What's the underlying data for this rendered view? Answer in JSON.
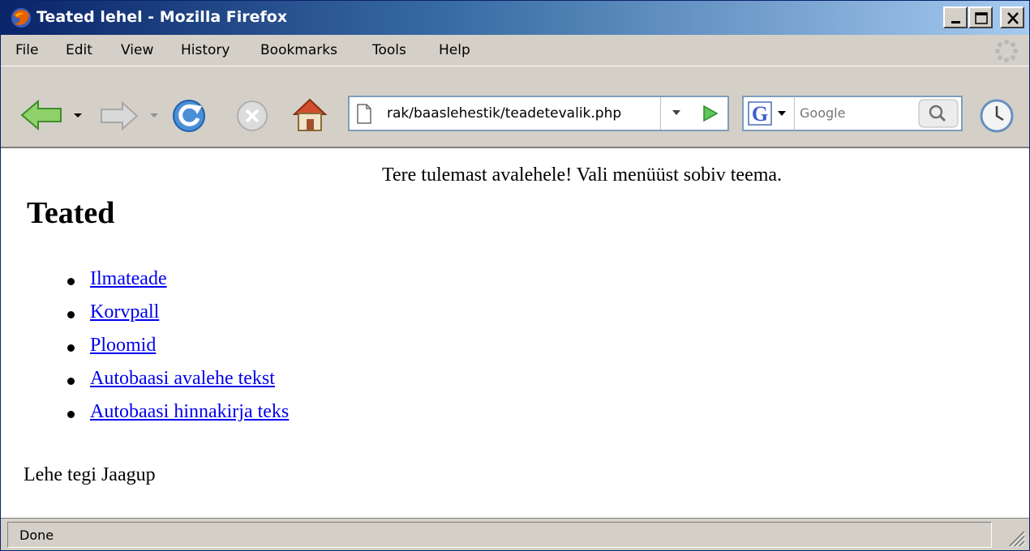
{
  "window": {
    "title": "Teated lehel - Mozilla Firefox",
    "buttons": {
      "minimize": "minimize",
      "maximize": "maximize",
      "close": "close"
    }
  },
  "menu": {
    "items": [
      "File",
      "Edit",
      "View",
      "History",
      "Bookmarks",
      "Tools",
      "Help"
    ]
  },
  "toolbar": {
    "url": "rak/baaslehestik/teadetevalik.php",
    "search_placeholder": "Google",
    "icons": [
      "back-arrow-icon",
      "forward-arrow-icon",
      "reload-icon",
      "stop-icon",
      "home-icon",
      "go-icon",
      "google-icon",
      "search-icon",
      "history-clock-icon"
    ]
  },
  "page": {
    "welcome": "Tere tulemast avalehele! Vali menüüst sobiv teema.",
    "heading": "Teated",
    "links": [
      "Ilmateade",
      "Korvpall",
      "Ploomid",
      "Autobaasi avalehe tekst",
      "Autobaasi hinnakirja teks"
    ],
    "footer": "Lehe tegi Jaagup"
  },
  "status": {
    "text": "Done"
  },
  "colors": {
    "title_gradient_start": "#0a246a",
    "title_gradient_end": "#a6caf0",
    "chrome": "#d4d0c8",
    "link": "#0000ee"
  }
}
